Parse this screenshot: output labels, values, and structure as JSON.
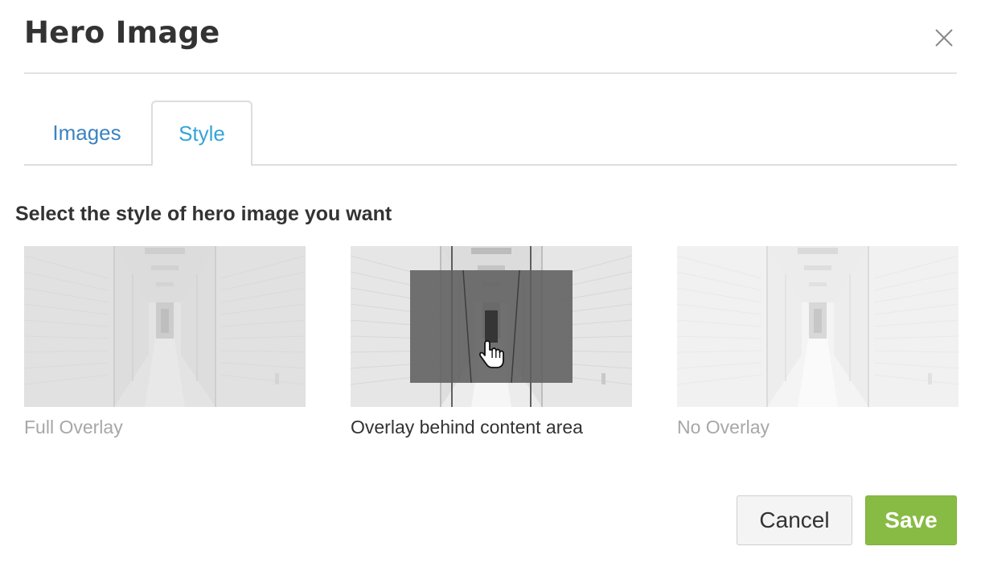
{
  "dialog": {
    "title": "Hero Image",
    "close_icon": "close-icon"
  },
  "tabs": [
    {
      "label": "Images",
      "active": false
    },
    {
      "label": "Style",
      "active": true
    }
  ],
  "section": {
    "heading": "Select the style of hero image you want"
  },
  "options": [
    {
      "label": "Full Overlay",
      "selected": false
    },
    {
      "label": "Overlay behind content area",
      "selected": true
    },
    {
      "label": "No Overlay",
      "selected": false
    }
  ],
  "footer": {
    "cancel_label": "Cancel",
    "save_label": "Save"
  },
  "colors": {
    "tab_inactive": "#3c83c0",
    "tab_active": "#35a4d8",
    "save_button": "#88bb43",
    "overlay": "#5f5f5f",
    "muted_label": "#a7a7a7"
  },
  "icons": [
    "close-icon",
    "hand-pointer-cursor-icon"
  ]
}
